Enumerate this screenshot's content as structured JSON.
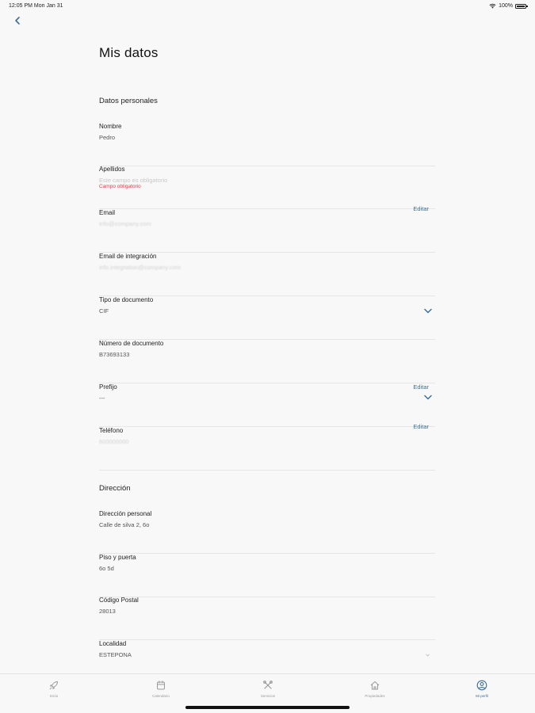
{
  "status_bar": {
    "time_date": "12:05 PM   Mon Jan 31",
    "battery": "100%"
  },
  "page": {
    "title": "Mis datos"
  },
  "sections": {
    "personal": "Datos personales",
    "address": "Dirección"
  },
  "fields": {
    "nombre": {
      "label": "Nombre",
      "value": "Pedro"
    },
    "apellidos": {
      "label": "Apellidos",
      "placeholder": "Este campo es obligatorio",
      "error": "Campo obligatorio"
    },
    "email": {
      "label": "Email",
      "value": "info@company.com",
      "action": "Editar"
    },
    "email_integracion": {
      "label": "Email de integración",
      "value": "info.integration@company.com"
    },
    "tipo_documento": {
      "label": "Tipo de documento",
      "value": "CIF"
    },
    "numero_documento": {
      "label": "Número de documento",
      "value": "B73693133"
    },
    "prefijo": {
      "label": "Prefijo",
      "value": "---",
      "action": "Editar"
    },
    "telefono": {
      "label": "Teléfono",
      "value": "600000000",
      "action": "Editar"
    },
    "direccion_personal": {
      "label": "Dirección personal",
      "value": "Calle de silva 2, 6o"
    },
    "piso_puerta": {
      "label": "Piso y puerta",
      "value": "6o 5d"
    },
    "codigo_postal": {
      "label": "Código Postal",
      "value": "28013"
    },
    "localidad": {
      "label": "Localidad",
      "value": "ESTEPONA"
    }
  },
  "tab_bar": {
    "items": [
      {
        "label": "Inicio",
        "icon": "rocket-icon"
      },
      {
        "label": "Calendario",
        "icon": "calendar-icon"
      },
      {
        "label": "Servicios",
        "icon": "tools-icon"
      },
      {
        "label": "Propiedades",
        "icon": "home-icon"
      },
      {
        "label": "Mi perfil",
        "icon": "user-circle-icon"
      }
    ],
    "active_index": 4
  },
  "colors": {
    "accent": "#3b6f9a",
    "error": "#e0404a",
    "background": "#f8f8f8"
  }
}
